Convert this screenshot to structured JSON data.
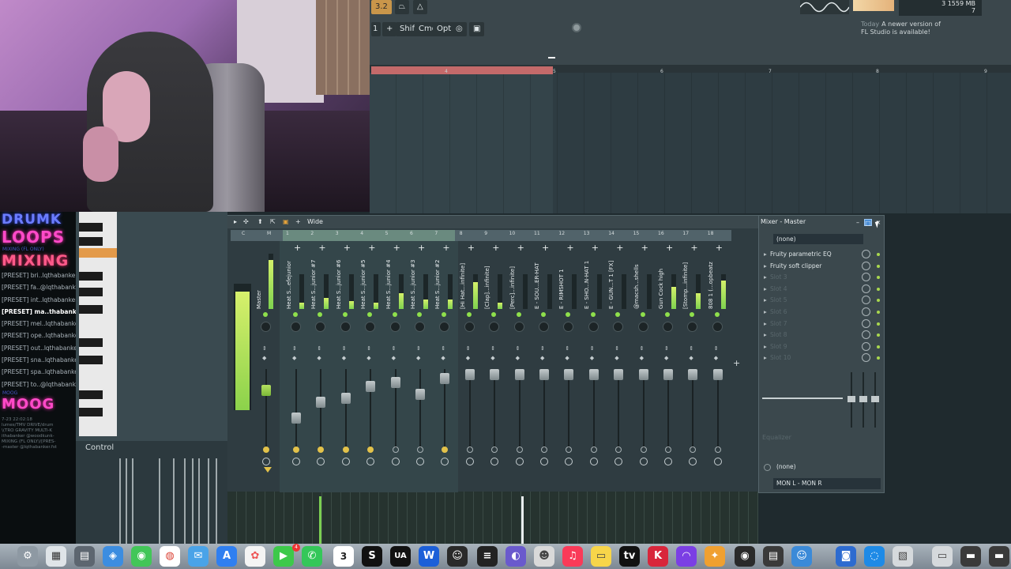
{
  "toolbar": {
    "pattern_num": "3.2",
    "snap_label": "1",
    "buttons": [
      "Shift",
      "Cmd",
      "Opt"
    ],
    "memory": "1559 MB",
    "cpu_count": "3",
    "voices": "7",
    "notice_today": "Today",
    "notice_line1": "A newer version of",
    "notice_line2": "FL Studio is available!"
  },
  "playlist": {
    "ruler_numbers": [
      "4",
      "5",
      "6",
      "7",
      "8",
      "9"
    ]
  },
  "overlay": {
    "brand_top": "DRUMK",
    "loops": "LOOPS",
    "mixing": "MIXING",
    "mixing_sub": "MIXING (FL ONLY)",
    "moog": "MOOG",
    "moog_sub": "MOOG",
    "presets": [
      "[PRESET] bri..lqthabanker",
      "[PRESET] fa..@lqthabanker",
      "[PRESET] int..lqthabanker",
      "[PRESET] ma..thabanker",
      "[PRESET] mel..lqthabanker",
      "[PRESET] ope..lqthabanker",
      "[PRESET] out..lqthabanker",
      "[PRESET] sna..lqthabanker",
      "[PRESET] spa..lqthabanker",
      "[PRESET] to..@lqthabanker"
    ],
    "selected_index": 3,
    "folder_info": [
      "7-23 22:02:18",
      "lumes/TMV DRIVE/drum",
      "\\(TRO GRAVITY MULTI-K",
      "ithabanker @woodkunk-",
      "MIXING (FL ONLY)/[PRES-",
      "-master @lqthabanker.fst"
    ]
  },
  "control": {
    "label": "Control"
  },
  "mixer": {
    "title_preset": "Wide",
    "header_labels": [
      "C",
      "M",
      "1",
      "2",
      "3",
      "4",
      "5",
      "6",
      "7",
      "8",
      "9",
      "10",
      "11",
      "12",
      "13",
      "14",
      "15",
      "16",
      "17",
      "18"
    ],
    "master_name": "Master",
    "tracks": [
      {
        "name": "Heat S...efejunior",
        "level": 0.2,
        "fader": 0.55,
        "send": true
      },
      {
        "name": "Heat S...junior #7",
        "level": 0.35,
        "fader": 0.35,
        "send": true
      },
      {
        "name": "Heat S...junior #6",
        "level": 0.25,
        "fader": 0.3,
        "send": true
      },
      {
        "name": "Heat S...junior #5",
        "level": 0.2,
        "fader": 0.15,
        "send": true
      },
      {
        "name": "Heat S...junior #4",
        "level": 0.5,
        "fader": 0.1,
        "send": false
      },
      {
        "name": "Heat S...junior #3",
        "level": 0.3,
        "fader": 0.25,
        "send": false
      },
      {
        "name": "Heat S...junior #2",
        "level": 0.3,
        "fader": 0.05,
        "send": true
      },
      {
        "name": "[Hi Hat...infinite]",
        "level": 0.85,
        "fader": 0.0,
        "send": false
      },
      {
        "name": "[Clap]...infinite]",
        "level": 0.2,
        "fader": 0.0,
        "send": false
      },
      {
        "name": "[Perc]...infinite]",
        "level": 0.0,
        "fader": 0.0,
        "send": false
      },
      {
        "name": "E - SOU...ER-HAT",
        "level": 0.0,
        "fader": 0.0,
        "send": false
      },
      {
        "name": "E - RIMSHOT 1",
        "level": 0.0,
        "fader": 0.0,
        "send": false
      },
      {
        "name": "E - SHO...N-HAT 1",
        "level": 0.0,
        "fader": 0.0,
        "send": false
      },
      {
        "name": "E - GUN...T 1 [FX]",
        "level": 0.0,
        "fader": 0.0,
        "send": false
      },
      {
        "name": "@macsh...shells",
        "level": 0.0,
        "fader": 0.0,
        "send": false
      },
      {
        "name": "Gun Cock high",
        "level": 0.7,
        "fader": 0.0,
        "send": false
      },
      {
        "name": "[Stomp...infinite]",
        "level": 0.5,
        "fader": 0.0,
        "send": false
      },
      {
        "name": "808 1 (...opbeatz",
        "level": 0.9,
        "fader": 0.0,
        "send": false
      }
    ]
  },
  "rack": {
    "title": "Mixer - Master",
    "preset": "(none)",
    "slots": [
      {
        "name": "Fruity parametric EQ",
        "filled": true
      },
      {
        "name": "Fruity soft clipper",
        "filled": true
      },
      {
        "name": "Slot 3",
        "filled": false
      },
      {
        "name": "Slot 4",
        "filled": false
      },
      {
        "name": "Slot 5",
        "filled": false
      },
      {
        "name": "Slot 6",
        "filled": false
      },
      {
        "name": "Slot 7",
        "filled": false
      },
      {
        "name": "Slot 8",
        "filled": false
      },
      {
        "name": "Slot 9",
        "filled": false
      },
      {
        "name": "Slot 10",
        "filled": false
      }
    ],
    "equalizer_label": "Equalizer",
    "output_none": "(none)",
    "route": "MON L - MON R"
  },
  "dock": {
    "calendar_day": "3",
    "ua_label": "UA",
    "notification_count": "4"
  }
}
